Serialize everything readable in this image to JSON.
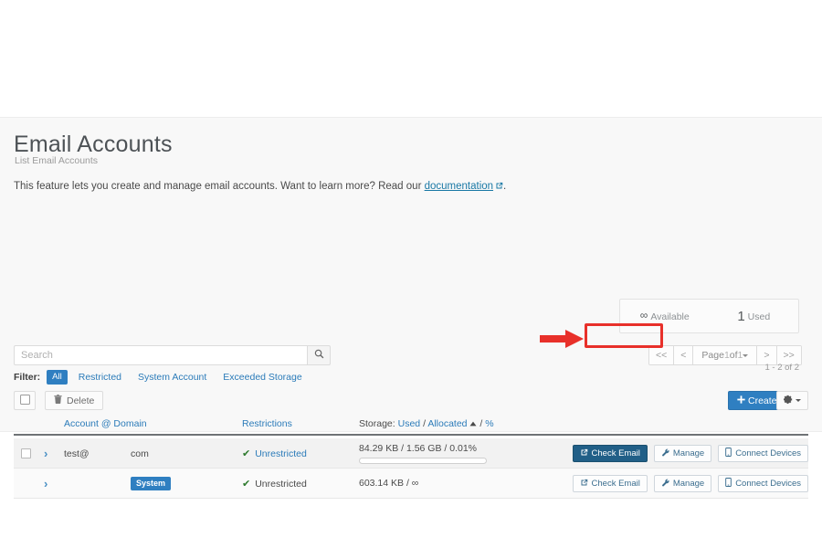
{
  "header": {
    "title": "Email Accounts",
    "breadcrumb": "List Email Accounts",
    "intro_before": "This feature lets you create and manage email accounts. Want to learn more? Read our ",
    "intro_link": "documentation",
    "intro_after": "."
  },
  "stats": {
    "available_value": "∞",
    "available_label": "Available",
    "used_value": "1",
    "used_label": "Used"
  },
  "pagination": {
    "first": "<<",
    "prev": "<",
    "page_prefix": "Page",
    "page_current": "1",
    "page_mid": "of",
    "page_total": "1",
    "next": ">",
    "last": ">>",
    "range": "1 - 2 of 2"
  },
  "search": {
    "placeholder": "Search",
    "value": "",
    "icon": "search-icon"
  },
  "filter": {
    "label": "Filter:",
    "options": [
      {
        "label": "All",
        "active": true
      },
      {
        "label": "Restricted",
        "active": false
      },
      {
        "label": "System Account",
        "active": false
      },
      {
        "label": "Exceeded Storage",
        "active": false
      }
    ]
  },
  "toolbar": {
    "delete_label": "Delete",
    "delete_icon": "trash-icon",
    "create_label": "Create",
    "create_icon": "plus-icon",
    "gear_icon": "gear-icon",
    "select_all_icon": "checkbox-icon"
  },
  "table": {
    "columns": {
      "account_domain": "Account @ Domain",
      "restrictions": "Restrictions",
      "storage_prefix": "Storage:",
      "storage_used": "Used",
      "storage_sep1": "/",
      "storage_allocated": "Allocated",
      "storage_sort_icon": "sort-asc-icon",
      "storage_sep2": "/",
      "storage_percent": "%"
    },
    "rows": [
      {
        "has_checkbox": true,
        "expand_icon": "chevron-right-icon",
        "account": "test@",
        "domain": "com",
        "badge": null,
        "restriction_icon": "check-icon",
        "restriction": "Unrestricted",
        "restriction_is_link": true,
        "storage": "84.29 KB / 1.56 GB / 0.01%",
        "storage_percent_fill": 0.01,
        "show_progress": true,
        "actions": [
          {
            "label": "Check Email",
            "icon": "external-link-icon",
            "primary": true
          },
          {
            "label": "Manage",
            "icon": "wrench-icon",
            "primary": false
          },
          {
            "label": "Connect Devices",
            "icon": "device-icon",
            "primary": false
          }
        ]
      },
      {
        "has_checkbox": false,
        "expand_icon": "chevron-right-icon",
        "account": "",
        "domain": "",
        "badge": "System",
        "restriction_icon": "check-icon",
        "restriction": "Unrestricted",
        "restriction_is_link": false,
        "storage": "603.14 KB / ∞",
        "storage_percent_fill": 0,
        "show_progress": false,
        "actions": [
          {
            "label": "Check Email",
            "icon": "external-link-icon",
            "primary": false
          },
          {
            "label": "Manage",
            "icon": "wrench-icon",
            "primary": false
          },
          {
            "label": "Connect Devices",
            "icon": "device-icon",
            "primary": false
          }
        ]
      }
    ]
  },
  "annotation": {
    "color": "#e8302a",
    "arrow_icon": "arrow-right-icon",
    "target": "Check Email"
  }
}
